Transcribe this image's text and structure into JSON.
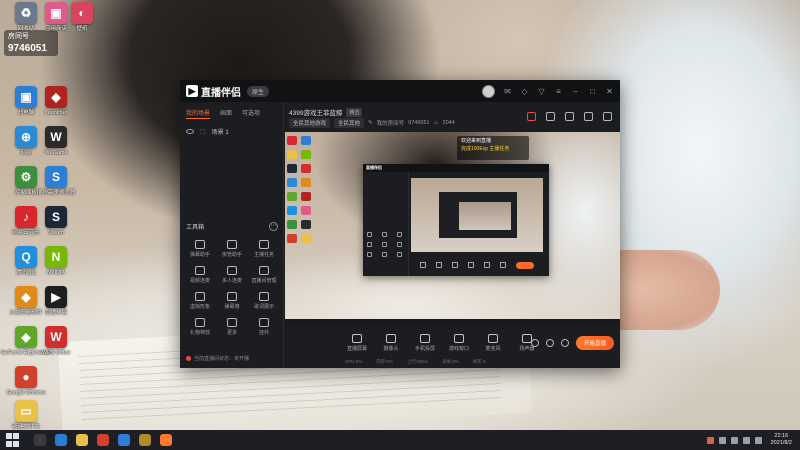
{
  "desktop": {
    "room_badge": {
      "label": "房间号",
      "number": "9746051"
    },
    "icons": [
      {
        "name": "recycle-bin-icon",
        "label": "回收站",
        "color": "#6b7a8a",
        "glyph": "♻"
      },
      {
        "name": "this-pc-icon",
        "label": "此电脑",
        "color": "#2d7fd6",
        "glyph": "▣"
      },
      {
        "name": "network-icon",
        "label": "网络",
        "color": "#2a8ad4",
        "glyph": "⊕"
      },
      {
        "name": "control-panel-icon",
        "label": "控制面板",
        "color": "#3c8f3c",
        "glyph": "⚙"
      },
      {
        "name": "netease-music-icon",
        "label": "网易云音乐",
        "color": "#d8282d",
        "glyph": "♪"
      },
      {
        "name": "qq-icon",
        "label": "腾讯QQ",
        "color": "#1f8fe0",
        "glyph": "Q"
      },
      {
        "name": "security-icon",
        "label": "火绒安全软件",
        "color": "#e08a1a",
        "glyph": "◆"
      },
      {
        "name": "geforce-icon",
        "label": "GeForce Experience",
        "color": "#5fa62a",
        "glyph": "◈"
      },
      {
        "name": "chrome-icon",
        "label": "Google Chrome",
        "color": "#d0402d",
        "glyph": "●"
      },
      {
        "name": "folder-icon",
        "label": "新建文件夹",
        "color": "#e8c04a",
        "glyph": "▭"
      },
      {
        "name": "app-red-icon",
        "label": "Launcher",
        "color": "#b0231f",
        "glyph": "◆"
      },
      {
        "name": "wegame-icon",
        "label": "WeGame",
        "color": "#2a2a2a",
        "glyph": "W"
      },
      {
        "name": "sogou-browser-icon",
        "label": "搜狗高速浏览器",
        "color": "#2c7fd4",
        "glyph": "S"
      },
      {
        "name": "steam-icon",
        "label": "Steam",
        "color": "#1b2838",
        "glyph": "S"
      },
      {
        "name": "nvidia-icon",
        "label": "NVIDIA",
        "color": "#76b900",
        "glyph": "N"
      },
      {
        "name": "live-companion-icon",
        "label": "直播伴侣",
        "color": "#1e1e1e",
        "glyph": "▶"
      },
      {
        "name": "wps-icon",
        "label": "WPS Office",
        "color": "#d42d2d",
        "glyph": "W"
      },
      {
        "name": "store-icon",
        "label": "应用商店",
        "color": "#e05a8a",
        "glyph": "▣"
      },
      {
        "name": "wallpaper-icon",
        "label": "壁纸",
        "color": "#d9455f",
        "glyph": "◐"
      }
    ]
  },
  "app": {
    "title": "直播伴侣",
    "version_badge": "原生",
    "left_tabs": [
      "我的场景",
      "画面",
      "可选项"
    ],
    "scene": {
      "label": "场景 1"
    },
    "tools_title": "工具箱",
    "tools": [
      "弹幕助手",
      "房管助手",
      "主播任务",
      "视频连麦",
      "多人连麦",
      "直播间管理",
      "虚拟形象",
      "弹幕墙",
      "歌词展示",
      "礼物特效",
      "更多",
      "挂件"
    ],
    "left_status": "当前直播间状态：未开播",
    "room": {
      "title": "4399游戏王菲蓝鲸",
      "title_tag": "精选",
      "category": "全民其他游戏",
      "subcategory": "全民其他",
      "id_label": "我的房间号",
      "id": "9746051",
      "followers": "2044"
    },
    "notice": {
      "line1": "欢迎来到直播",
      "line2": "完成100Exp 主播任务"
    },
    "bottom_tools": [
      "直播屏幕",
      "摄像头",
      "手机投屏",
      "游戏窗口",
      "麦克风",
      "扬声器"
    ],
    "go_live_label": "开始直播",
    "stats": [
      "CPU:0%",
      "内存:0%",
      "上行:0kb/s",
      "丢帧:0%",
      "帧率:0"
    ]
  },
  "taskbar": {
    "time": "22:16",
    "date": "2021/8/2",
    "accent": "#ff7a2e"
  }
}
